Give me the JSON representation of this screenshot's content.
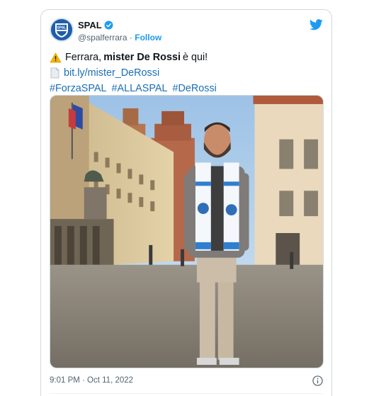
{
  "tweet": {
    "display_name": "SPAL",
    "handle": "@spalferrara",
    "separator": "·",
    "follow_label": "Follow",
    "avatar_text": "SPAL",
    "text": {
      "warning_emoji": "warning-icon",
      "line1_prefix": "Ferrara,",
      "line1_bold": "mister De Rossi",
      "line1_suffix": "è qui!",
      "link_icon": "document-icon",
      "link": "bit.ly/mister_DeRossi",
      "hashtags": [
        "#ForzaSPAL",
        "#ALLASPAL",
        "#DeRossi"
      ]
    },
    "timestamp": "9:01 PM · Oct 11, 2022"
  },
  "icons": {
    "verified": "verified-badge-icon",
    "brand": "twitter-bird-icon",
    "info": "info-icon"
  },
  "colors": {
    "accent": "#1d9bf0",
    "link": "#1b6fb5",
    "border": "#cfd9de",
    "muted": "#536471",
    "spal_blue": "#1f5ea8"
  }
}
